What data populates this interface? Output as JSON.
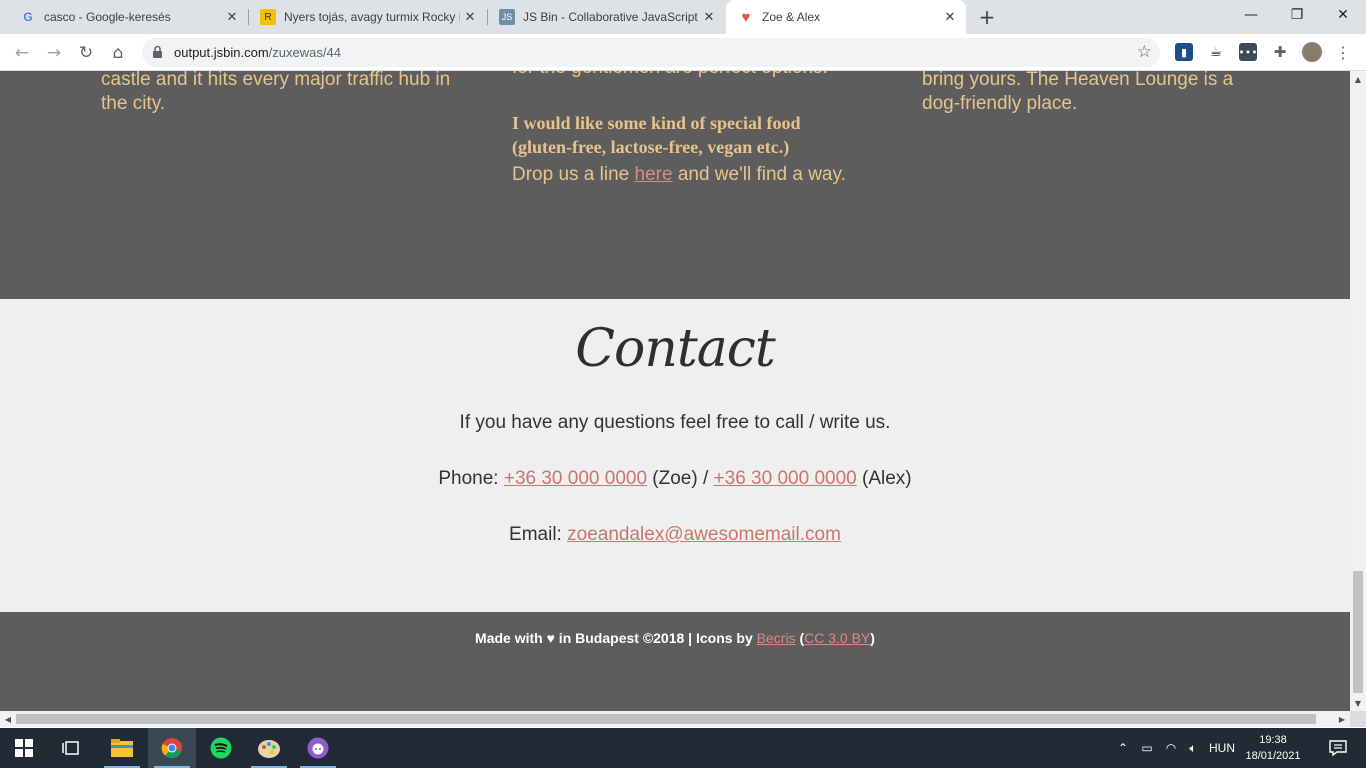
{
  "tabs": [
    {
      "label": "casco - Google-keresés",
      "icon": "google-icon"
    },
    {
      "label": "Nyers tojás, avagy turmix Rocky B",
      "icon": "rocky-favicon"
    },
    {
      "label": "JS Bin - Collaborative JavaScript D",
      "icon": "jsbin-favicon"
    },
    {
      "label": "Zoe & Alex",
      "icon": "heart-favicon"
    }
  ],
  "window_controls": {
    "minimize": "—",
    "maximize": "❐",
    "close": "✕"
  },
  "omnibox": {
    "host": "output.jsbin.com",
    "path": "/zuxewas/44"
  },
  "page": {
    "col1": {
      "text": "castle and it hits every major traffic hub in the city."
    },
    "col2": {
      "top_text": "for the gentlemen are perfect options.",
      "question": "I would like some kind of special food (gluten-free, lactose-free, vegan etc.)",
      "answer_pre": "Drop us a line ",
      "answer_link": "here",
      "answer_post": " and we'll find a way."
    },
    "col3": {
      "text": "bring yours. The Heaven Lounge is a dog-friendly place."
    },
    "contact": {
      "title": "Contact",
      "intro": "If you have any questions feel free to call / write us.",
      "phone_label": "Phone: ",
      "phone_zoe": "+36 30 000 0000",
      "zoe_suffix": " (Zoe) / ",
      "phone_alex": "+36 30 000 0000",
      "alex_suffix": " (Alex)",
      "email_label": "Email: ",
      "email": "zoeandalex@awesomemail.com"
    },
    "footer": {
      "pre": "Made with ♥ in Budapest ©2018 | Icons by ",
      "icons_author": "Becris",
      "open_paren": " (",
      "license": "CC 3.0 BY",
      "close_paren": ")"
    }
  },
  "taskbar": {
    "lang": "HUN",
    "time": "19:38",
    "date": "18/01/2021"
  },
  "colors": {
    "dark_bg": "#5d5d5d",
    "gold_text": "#e8c38e",
    "link_pink": "#d88b82",
    "light_bg": "#efefef"
  }
}
